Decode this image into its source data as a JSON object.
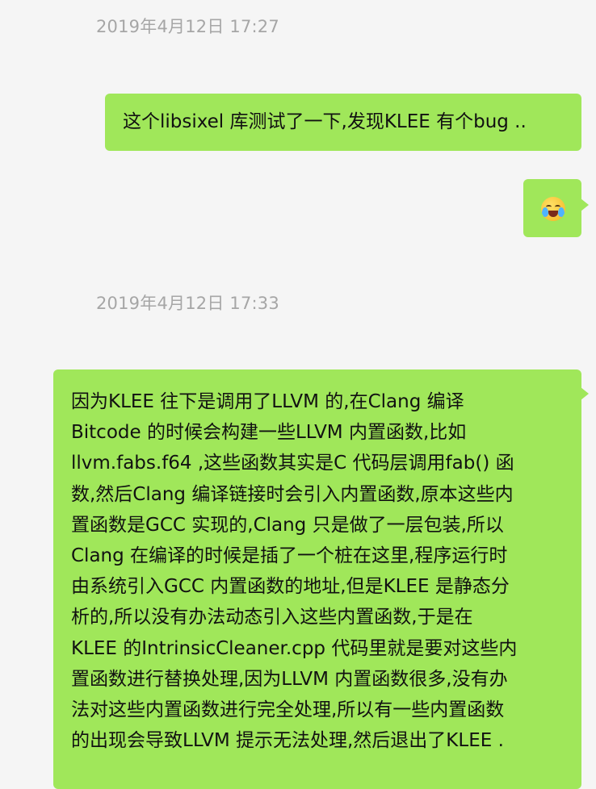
{
  "messages": [
    {
      "timestamp": "2019年4月12日 17:27"
    },
    {
      "text": "这个libsixel 库测试了一下,发现KLEE 有个bug .."
    },
    {
      "emoji": "face-with-tears-emoji"
    },
    {
      "timestamp": "2019年4月12日 17:33"
    },
    {
      "lines": [
        "因为KLEE 往下是调用了LLVM 的,在Clang 编译",
        "Bitcode 的时候会构建一些LLVM 内置函数,比如",
        "llvm.fabs.f64 ,这些函数其实是C 代码层调用fab() 函",
        "数,然后Clang 编译链接时会引入内置函数,原本这些内",
        "置函数是GCC 实现的,Clang 只是做了一层包装,所以",
        "Clang 在编译的时候是插了一个桩在这里,程序运行时",
        "由系统引入GCC 内置函数的地址,但是KLEE 是静态分",
        "析的,所以没有办法动态引入这些内置函数,于是在",
        "KLEE 的IntrinsicCleaner.cpp 代码里就是要对这些内",
        "置函数进行替换处理,因为LLVM 内置函数很多,没有办",
        "法对这些内置函数进行完全处理,所以有一些内置函数",
        "的出现会导致LLVM 提示无法处理,然后退出了KLEE ."
      ]
    }
  ],
  "colors": {
    "background": "#f5f5f5",
    "bubble": "#a0e75a",
    "timestamp": "#a6a6a6",
    "text": "#111111"
  }
}
